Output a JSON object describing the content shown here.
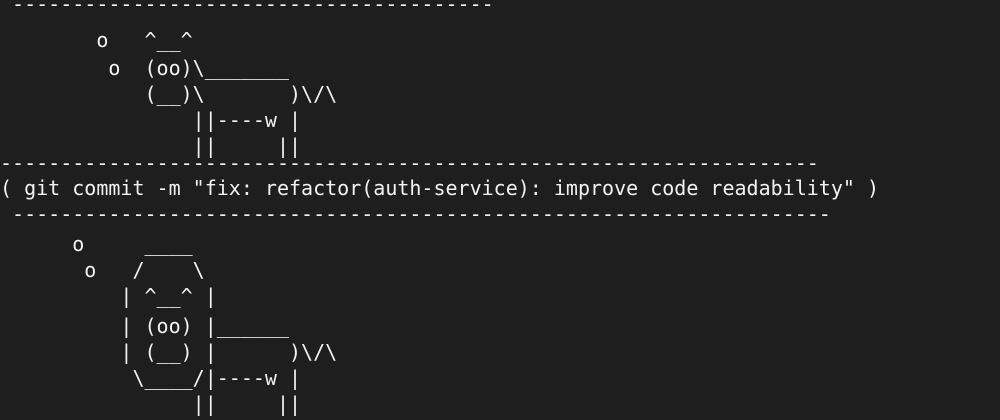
{
  "terminal": {
    "lines": [
      " ----------------------------------------",
      "        o   ^__^",
      "         o  (oo)\\_______",
      "            (__)\\       )\\/\\",
      "                ||----w |",
      "                ||     ||",
      "--------------------------------------------------------------------",
      "( git commit -m \"fix: refactor(auth-service): improve code readability\" )",
      " --------------------------------------------------------------------",
      "      o     ____",
      "       o   /    \\",
      "          | ^__^ |",
      "          | (oo) |______",
      "          | (__) |      )\\/\\",
      "           \\____/|----w |",
      "                ||     ||"
    ]
  }
}
